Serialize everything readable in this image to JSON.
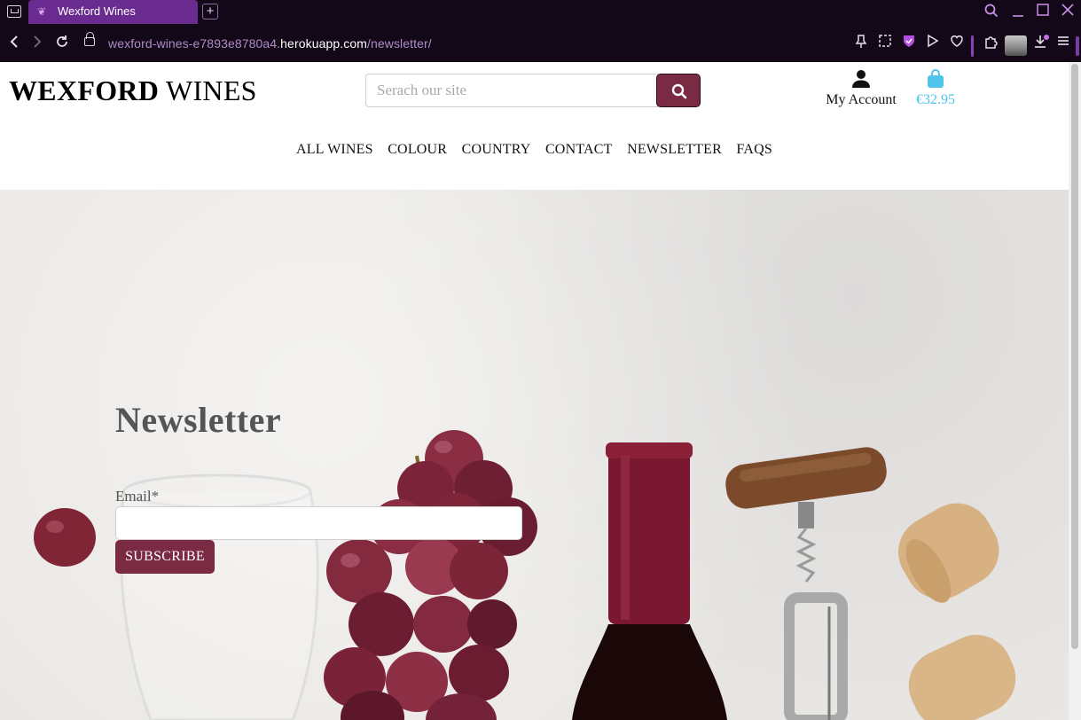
{
  "browser": {
    "tab_title": "Wexford Wines",
    "new_tab": "+",
    "url_prefix": "wexford-wines-e7893e8780a4.",
    "url_host": "herokuapp.com",
    "url_path": "/newsletter/"
  },
  "header": {
    "logo_bold": "WEXFORD",
    "logo_light": "WINES",
    "search_placeholder": "Serach our site",
    "account_label": "My Account",
    "bag_total": "€32.95"
  },
  "nav": {
    "items": [
      "ALL WINES",
      "COLOUR",
      "COUNTRY",
      "CONTACT",
      "NEWSLETTER",
      "FAQS"
    ]
  },
  "newsletter": {
    "title": "Newsletter",
    "email_label": "Email*",
    "subscribe_label": "SUBSCRIBE"
  },
  "colors": {
    "brand": "#7a2a42",
    "accent": "#4fc3ea",
    "browser_accent": "#6a2b91"
  }
}
